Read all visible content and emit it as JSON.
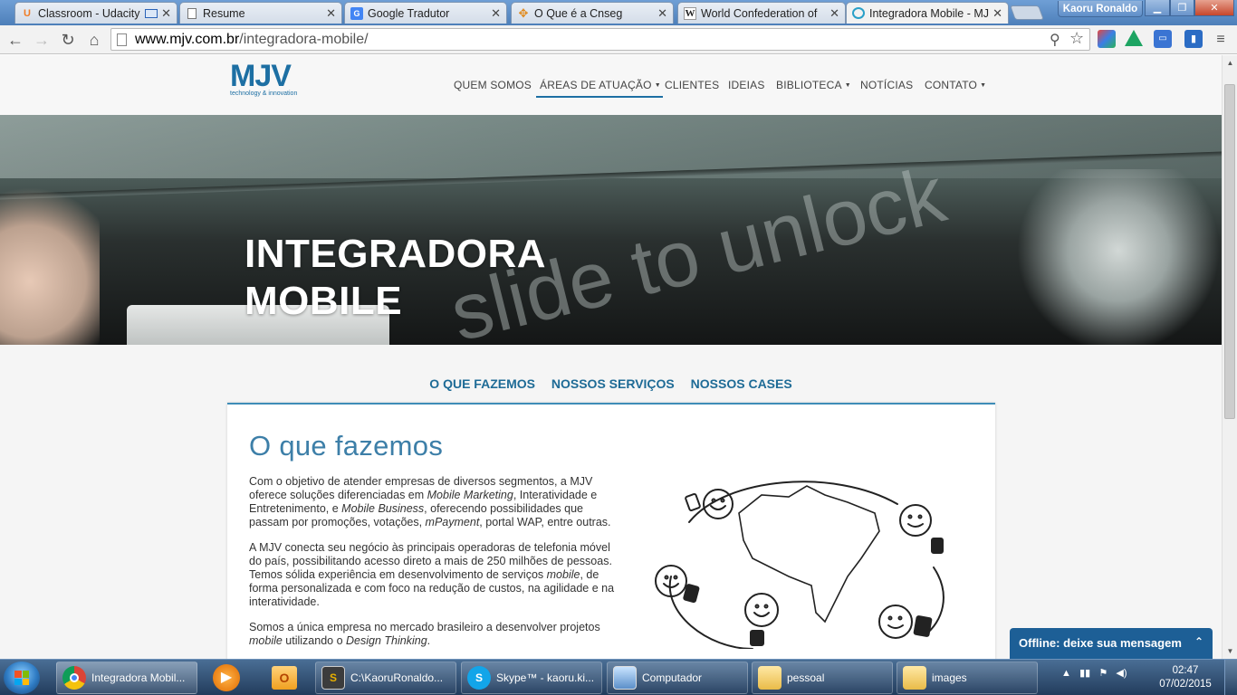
{
  "browser": {
    "tabs": [
      {
        "title": "Classroom - Udacity",
        "favicon": "U"
      },
      {
        "title": "Resume",
        "favicon": ""
      },
      {
        "title": "Google Tradutor",
        "favicon": ""
      },
      {
        "title": "O Que é a Cnseg",
        "favicon": ""
      },
      {
        "title": "World Confederation of",
        "favicon": "W"
      },
      {
        "title": "Integradora Mobile - MJV",
        "favicon": ""
      }
    ],
    "user": "Kaoru Ronaldo",
    "url_host": "www.mjv.com.br",
    "url_path": "/integradora-mobile/"
  },
  "site": {
    "logo_text": "MJV",
    "logo_tagline": "technology & innovation",
    "nav": {
      "quem_somos": "QUEM SOMOS",
      "areas": "ÁREAS DE ATUAÇÃO",
      "clientes": "CLIENTES",
      "ideias": "IDEIAS",
      "biblioteca": "BIBLIOTECA",
      "noticias": "NOTÍCIAS",
      "contato": "CONTATO"
    },
    "hero_title_line1": "INTEGRADORA",
    "hero_title_line2": "MOBILE",
    "hero_photo_text": "slide to unlock",
    "subnav": {
      "o_que_fazemos": "O QUE FAZEMOS",
      "nossos_servicos": "NOSSOS SERVIÇOS",
      "nossos_cases": "NOSSOS CASES"
    },
    "section_title": "O que fazemos",
    "p1": {
      "a": "Com o objetivo de atender empresas de diversos segmentos, a MJV oferece soluções diferenciadas em ",
      "b": "Mobile Marketing",
      "c": ", Interatividade e Entretenimento, e ",
      "d": "Mobile Business",
      "e": ", oferecendo possibilidades que passam por promoções, votações, ",
      "f": "mPayment",
      "g": ", portal WAP, entre outras."
    },
    "p2": {
      "a": "A MJV conecta seu negócio às principais operadoras de telefonia móvel do país, possibilitando acesso direto a mais de 250 milhões de pessoas. Temos sólida experiência em desenvolvimento de serviços ",
      "b": "mobile",
      "c": ", de forma personalizada e com foco na redução de custos, na agilidade e na interatividade."
    },
    "p3": {
      "a": "Somos a única empresa no mercado brasileiro a desenvolver projetos ",
      "b": "mobile",
      "c": " utilizando o ",
      "d": "Design Thinking",
      "e": "."
    },
    "chat_label": "Offline: deixe sua mensagem"
  },
  "taskbar": {
    "items": {
      "chrome": "Integradora Mobil...",
      "cmd": "C:\\KaoruRonaldo...",
      "skype": "Skype™ - kaoru.ki...",
      "computador": "Computador",
      "pessoal": "pessoal",
      "images": "images"
    },
    "time": "02:47",
    "date": "07/02/2015"
  }
}
